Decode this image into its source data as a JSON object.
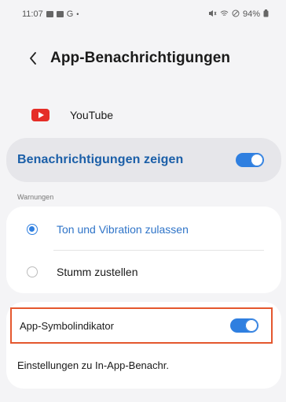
{
  "status_bar": {
    "time": "11:07",
    "dot": "•",
    "battery": "94%"
  },
  "header": {
    "title": "App-Benachrichtigungen"
  },
  "app": {
    "name": "YouTube"
  },
  "main_toggle": {
    "label": "Benachrichtigungen zeigen",
    "on": true
  },
  "section": {
    "label": "Warnungen"
  },
  "options": [
    {
      "label": "Ton und Vibration zulassen",
      "selected": true
    },
    {
      "label": "Stumm zustellen",
      "selected": false
    }
  ],
  "badge_setting": {
    "label": "App-Symbolindikator",
    "on": true
  },
  "in_app": {
    "label": "Einstellungen zu In-App-Benachr."
  },
  "colors": {
    "accent": "#2f7fe0",
    "highlight_border": "#e4572e",
    "youtube_red": "#e52d27"
  }
}
